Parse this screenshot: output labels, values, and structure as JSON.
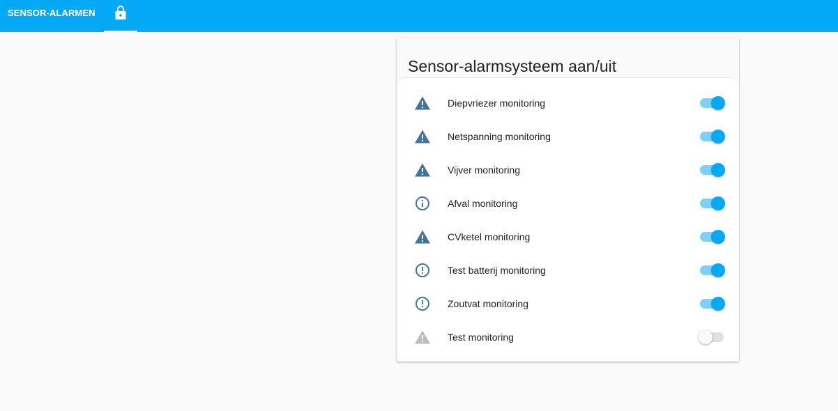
{
  "header": {
    "tab_label": "SENSOR-ALARMEN",
    "lock_icon": "lock-icon"
  },
  "card": {
    "title": "Sensor-alarmsysteem aan/uit",
    "rows": [
      {
        "label": "Diepvriezer monitoring",
        "icon": "alert-icon",
        "on": true
      },
      {
        "label": "Netspanning monitoring",
        "icon": "alert-icon",
        "on": true
      },
      {
        "label": "Vijver monitoring",
        "icon": "alert-icon",
        "on": true
      },
      {
        "label": "Afval monitoring",
        "icon": "information-outline-icon",
        "on": true
      },
      {
        "label": "CVketel monitoring",
        "icon": "alert-icon",
        "on": true
      },
      {
        "label": "Test batterij monitoring",
        "icon": "alert-circle-outline-icon",
        "on": true
      },
      {
        "label": "Zoutvat monitoring",
        "icon": "alert-circle-outline-icon",
        "on": true
      },
      {
        "label": "Test monitoring",
        "icon": "alert-icon",
        "on": false
      }
    ]
  },
  "colors": {
    "header": "#03a9f4",
    "icon_active": "#44739e",
    "icon_inactive": "#bdbdbd",
    "switch_on": "#03a9f4"
  }
}
